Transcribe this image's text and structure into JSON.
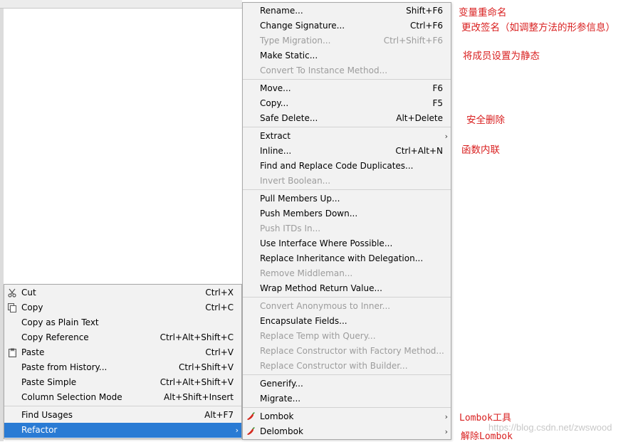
{
  "edit_menu": {
    "items": [
      {
        "label": "Cut",
        "shortcut": "Ctrl+X",
        "icon": "scissors-icon"
      },
      {
        "label": "Copy",
        "shortcut": "Ctrl+C",
        "icon": "copy-icon"
      },
      {
        "label": "Copy as Plain Text",
        "shortcut": ""
      },
      {
        "label": "Copy Reference",
        "shortcut": "Ctrl+Alt+Shift+C"
      },
      {
        "label": "Paste",
        "shortcut": "Ctrl+V",
        "icon": "clipboard-icon"
      },
      {
        "label": "Paste from History...",
        "shortcut": "Ctrl+Shift+V"
      },
      {
        "label": "Paste Simple",
        "shortcut": "Ctrl+Alt+Shift+V"
      },
      {
        "label": "Column Selection Mode",
        "shortcut": "Alt+Shift+Insert"
      },
      {
        "label": "Find Usages",
        "shortcut": "Alt+F7"
      },
      {
        "label": "Refactor",
        "shortcut": "",
        "submenu": true,
        "selected": true
      }
    ]
  },
  "refactor_menu": {
    "items": [
      {
        "label": "Rename...",
        "shortcut": "Shift+F6",
        "enabled": true
      },
      {
        "label": "Change Signature...",
        "shortcut": "Ctrl+F6",
        "enabled": true
      },
      {
        "label": "Type Migration...",
        "shortcut": "Ctrl+Shift+F6",
        "enabled": false
      },
      {
        "label": "Make Static...",
        "shortcut": "",
        "enabled": true
      },
      {
        "label": "Convert To Instance Method...",
        "shortcut": "",
        "enabled": false
      },
      {
        "label": "Move...",
        "shortcut": "F6",
        "enabled": true
      },
      {
        "label": "Copy...",
        "shortcut": "F5",
        "enabled": true
      },
      {
        "label": "Safe Delete...",
        "shortcut": "Alt+Delete",
        "enabled": true
      },
      {
        "label": "Extract",
        "shortcut": "",
        "enabled": true,
        "submenu": true
      },
      {
        "label": "Inline...",
        "shortcut": "Ctrl+Alt+N",
        "enabled": true
      },
      {
        "label": "Find and Replace Code Duplicates...",
        "shortcut": "",
        "enabled": true
      },
      {
        "label": "Invert Boolean...",
        "shortcut": "",
        "enabled": false
      },
      {
        "label": "Pull Members Up...",
        "shortcut": "",
        "enabled": true
      },
      {
        "label": "Push Members Down...",
        "shortcut": "",
        "enabled": true
      },
      {
        "label": "Push ITDs In...",
        "shortcut": "",
        "enabled": false
      },
      {
        "label": "Use Interface Where Possible...",
        "shortcut": "",
        "enabled": true
      },
      {
        "label": "Replace Inheritance with Delegation...",
        "shortcut": "",
        "enabled": true
      },
      {
        "label": "Remove Middleman...",
        "shortcut": "",
        "enabled": false
      },
      {
        "label": "Wrap Method Return Value...",
        "shortcut": "",
        "enabled": true
      },
      {
        "label": "Convert Anonymous to Inner...",
        "shortcut": "",
        "enabled": false
      },
      {
        "label": "Encapsulate Fields...",
        "shortcut": "",
        "enabled": true
      },
      {
        "label": "Replace Temp with Query...",
        "shortcut": "",
        "enabled": false
      },
      {
        "label": "Replace Constructor with Factory Method...",
        "shortcut": "",
        "enabled": false
      },
      {
        "label": "Replace Constructor with Builder...",
        "shortcut": "",
        "enabled": false
      },
      {
        "label": "Generify...",
        "shortcut": "",
        "enabled": true
      },
      {
        "label": "Migrate...",
        "shortcut": "",
        "enabled": true
      },
      {
        "label": "Lombok",
        "shortcut": "",
        "enabled": true,
        "submenu": true,
        "icon": "chili-pepper-icon"
      },
      {
        "label": "Delombok",
        "shortcut": "",
        "enabled": true,
        "submenu": true,
        "icon": "chili-pepper-icon"
      }
    ]
  },
  "annotations": {
    "rename": "变量重命名",
    "change_signature": "更改签名（如调整方法的形参信息）",
    "make_static": "将成员设置为静态",
    "safe_delete": "安全删除",
    "inline": "函数内联",
    "lombok": "Lombok工具",
    "delombok": "解除Lombok"
  },
  "watermark": "https://blog.csdn.net/zwswood",
  "colors": {
    "annotation": "#d92020",
    "selection": "#2a7bd4",
    "menu_bg": "#f2f2f2",
    "disabled": "#9c9c9c"
  }
}
